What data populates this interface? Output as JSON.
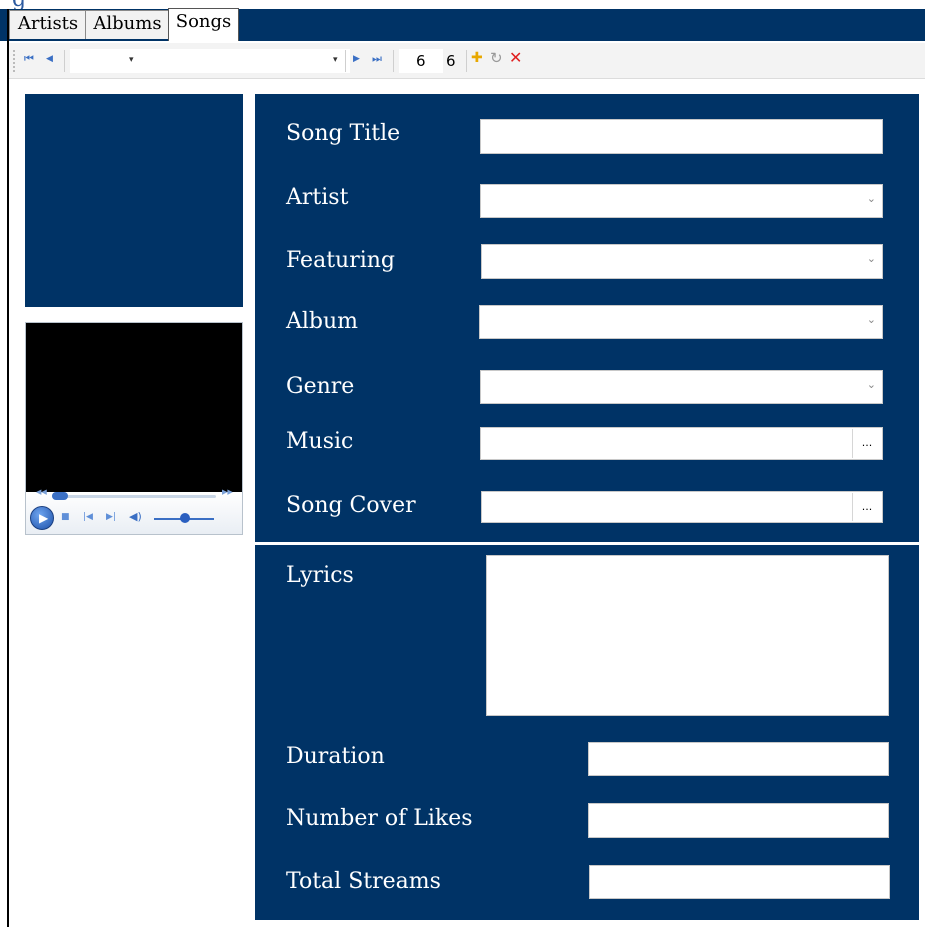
{
  "window": {
    "title_fragment": "g"
  },
  "tabs": [
    {
      "label": "Artists",
      "active": false
    },
    {
      "label": "Albums",
      "active": false
    },
    {
      "label": "Songs",
      "active": true
    }
  ],
  "toolbar": {
    "first_icon": "⏮",
    "prev_icon": "◀",
    "next_icon": "▶",
    "last_icon": "⏭",
    "position_value": "6",
    "count_value": "6",
    "add_icon": "✚",
    "refresh_icon": "↻",
    "delete_icon": "✕"
  },
  "form": {
    "song_title": {
      "label": "Song Title",
      "value": ""
    },
    "artist": {
      "label": "Artist",
      "value": ""
    },
    "featuring": {
      "label": "Featuring",
      "value": ""
    },
    "album": {
      "label": "Album",
      "value": ""
    },
    "genre": {
      "label": "Genre",
      "value": ""
    },
    "music": {
      "label": "Music",
      "value": "",
      "browse": "..."
    },
    "song_cover": {
      "label": "Song Cover",
      "value": "",
      "browse": "..."
    },
    "lyrics": {
      "label": "Lyrics",
      "value": ""
    },
    "duration": {
      "label": "Duration",
      "value": ""
    },
    "likes": {
      "label": "Number of Likes",
      "value": ""
    },
    "streams": {
      "label": "Total Streams",
      "value": ""
    }
  },
  "colors": {
    "navy": "#003366",
    "accent_blue": "#3a6fc4",
    "add_yellow": "#e8a800",
    "delete_red": "#e02020"
  }
}
